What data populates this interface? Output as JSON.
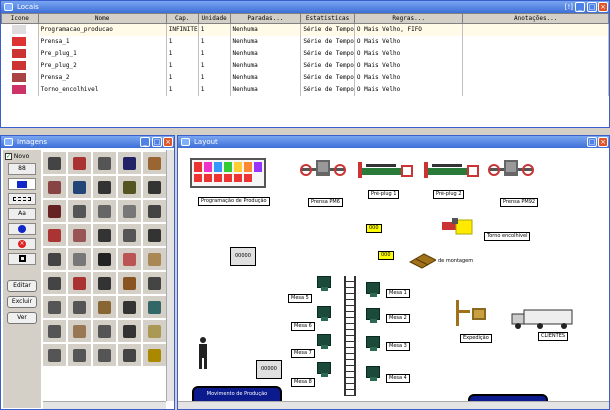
{
  "locais": {
    "title": "Locais",
    "title_right": "[!]",
    "headers": [
      "Icone",
      "Nome",
      "Cap.",
      "Unidade",
      "Paradas...",
      "Estatisticas",
      "Regras...",
      "Anotações..."
    ],
    "rows": [
      [
        "Programacao_producao",
        "INFINITE",
        "1",
        "Nenhuma",
        "Série de Tempo",
        "O Mais Velho, FIFO",
        ""
      ],
      [
        "Prensa_1",
        "1",
        "1",
        "Nenhuma",
        "Série de Tempo",
        "O Mais Velho",
        ""
      ],
      [
        "Pre_plug_1",
        "1",
        "1",
        "Nenhuma",
        "Série de Tempo",
        "O Mais Velho",
        ""
      ],
      [
        "Pre_plug_2",
        "1",
        "1",
        "Nenhuma",
        "Série de Tempo",
        "O Mais Velho",
        ""
      ],
      [
        "Prensa_2",
        "1",
        "1",
        "Nenhuma",
        "Série de Tempo",
        "O Mais Velho",
        ""
      ],
      [
        "Torno_encolhivel",
        "1",
        "1",
        "Nenhuma",
        "Série de Tempo",
        "O Mais Velho",
        ""
      ]
    ]
  },
  "imagens": {
    "title": "Imagens",
    "novo": "Novo",
    "tools": [
      "88",
      "",
      "",
      "Aa",
      "",
      "",
      ""
    ],
    "buttons": [
      "Editar",
      "Excluir",
      "Ver"
    ]
  },
  "layout": {
    "title": "Layout",
    "labels": {
      "prog": "Programação de Produção",
      "prensa1": "Prensa PM6",
      "preplug1": "Pré-plug 1",
      "preplug2": "Pré-plug 2",
      "prensa2": "Prensa PM92",
      "torno": "Torno encolhivel",
      "montagem": "de montagem",
      "expedicao": "Expedição",
      "clientes": "CLIENTES",
      "mov": "Movimento de Produção",
      "m1": "Mesa 1",
      "m2": "Mesa 2",
      "m3": "Mesa 3",
      "m4": "Mesa 4",
      "m5": "Mesa 5",
      "m6": "Mesa 6",
      "m7": "Mesa 7",
      "m8": "Mesa 8"
    },
    "counters": [
      "000",
      "000",
      "00000",
      "00000"
    ]
  },
  "colors": {
    "title_bar": "#3d6fd8",
    "close": "#e0562c",
    "workstation": "#1b4a3a",
    "counter": "#ffff00"
  }
}
